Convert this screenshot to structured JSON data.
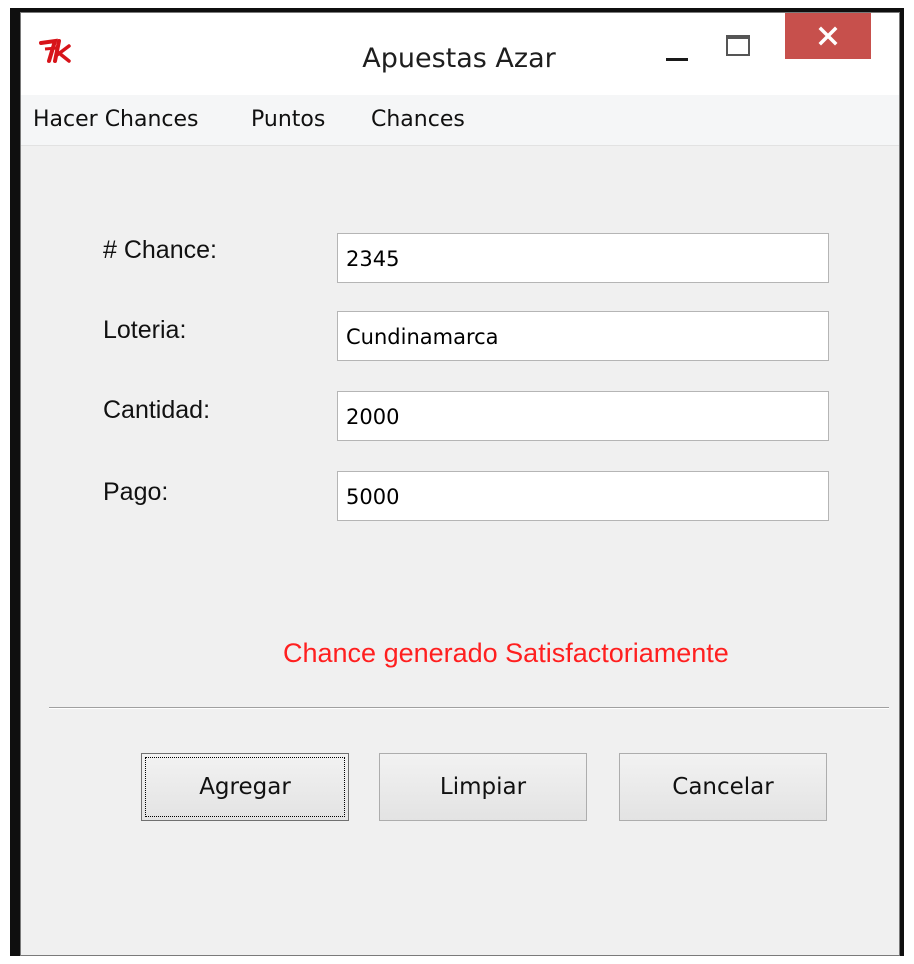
{
  "window": {
    "title": "Apuestas Azar"
  },
  "menu": {
    "items": [
      "Hacer Chances",
      "Puntos",
      "Chances"
    ]
  },
  "form": {
    "chance_label": "# Chance:",
    "chance_value": "2345",
    "loteria_label": "Loteria:",
    "loteria_value": "Cundinamarca",
    "cantidad_label": "Cantidad:",
    "cantidad_value": "2000",
    "pago_label": "Pago:",
    "pago_value": "5000"
  },
  "status": {
    "message": "Chance generado Satisfactoriamente",
    "color": "#ff1f1f"
  },
  "buttons": {
    "agregar": "Agregar",
    "limpiar": "Limpiar",
    "cancelar": "Cancelar"
  },
  "icons": {
    "app": "tk-icon",
    "minimize": "minimize-icon",
    "maximize": "maximize-icon",
    "close": "close-icon"
  },
  "colors": {
    "close_button": "#c7504c",
    "window_background": "#f0f0f0"
  }
}
